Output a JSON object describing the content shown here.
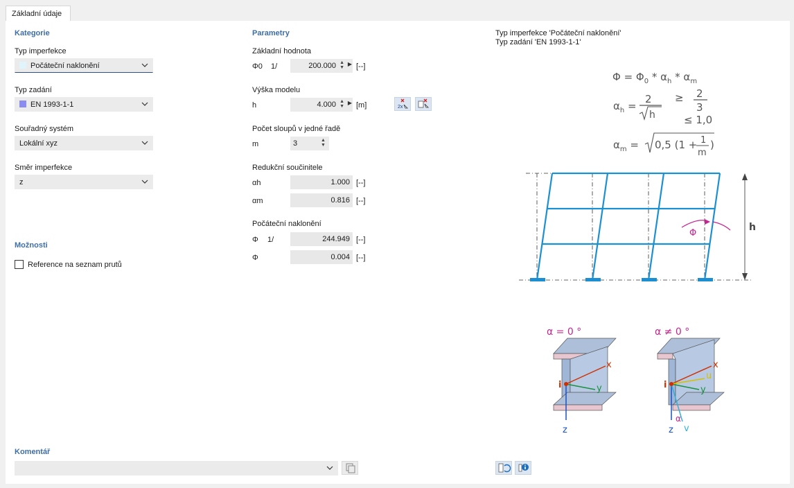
{
  "tab": {
    "label": "Základní údaje"
  },
  "kategorie": {
    "title": "Kategorie",
    "typ_imperfekce": {
      "label": "Typ imperfekce",
      "value": "Počáteční naklonění",
      "swatch": "#dff4fb"
    },
    "typ_zadani": {
      "label": "Typ zadání",
      "value": "EN 1993-1-1",
      "swatch": "#8c8cf0"
    },
    "soustava": {
      "label": "Souřadný systém",
      "value": "Lokální xyz"
    },
    "smer": {
      "label": "Směr imperfekce",
      "value": "z"
    }
  },
  "moznosti": {
    "title": "Možnosti",
    "reference_label": "Reference na seznam prutů",
    "reference_checked": false
  },
  "komentar": {
    "title": "Komentář",
    "value": ""
  },
  "parametry": {
    "title": "Parametry",
    "zakladni": {
      "label": "Základní hodnota",
      "sym": "Φ0",
      "prefix": "1/",
      "value": "200.000",
      "unit": "[--]"
    },
    "vyska": {
      "label": "Výška modelu",
      "sym": "h",
      "value": "4.000",
      "unit": "[m]"
    },
    "pocet": {
      "label": "Počet sloupů v jedné řadě",
      "sym": "m",
      "value": "3"
    },
    "redukcni": {
      "label": "Redukční součinitele",
      "ah": {
        "sym": "αh",
        "value": "1.000",
        "unit": "[--]"
      },
      "am": {
        "sym": "αm",
        "value": "0.816",
        "unit": "[--]"
      }
    },
    "naklon": {
      "label": "Počáteční naklonění",
      "phi_inv": {
        "sym": "Φ",
        "prefix": "1/",
        "value": "244.949",
        "unit": "[--]"
      },
      "phi": {
        "sym": "Φ",
        "value": "0.004",
        "unit": "[--]"
      }
    }
  },
  "info": {
    "line1": "Typ imperfekce 'Počáteční naklonění'",
    "line2": "Typ zadání 'EN 1993-1-1'",
    "formula": {
      "phi": "Φ = Φ",
      "phi_sub": "0",
      "phi_rest1": " * α",
      "phi_rest2": " * α",
      "h_sub": "h",
      "m_sub": "m",
      "ah_lhs": "α",
      "two": "2",
      "sqrt_h": "h",
      "ge": "≥",
      "two_b": "2",
      "three": "3",
      "le": "≤ 1,0",
      "am_lhs": "α",
      "am_expr": "0,5 (1 +",
      "one": "1",
      "m": "m",
      "close": ")"
    },
    "frame_label_h": "h",
    "frame_label_phi": "Φ",
    "section1": {
      "label": "α = 0 °",
      "x": "x",
      "y": "y",
      "z": "z",
      "i": "i"
    },
    "section2": {
      "label": "α ≠ 0 °",
      "x": "x",
      "y": "y",
      "z": "z",
      "i": "i",
      "u": "u",
      "v": "v",
      "alpha": "α"
    }
  },
  "colors": {
    "accent": "#3d6ea8",
    "frame": "#1b8fd2",
    "magenta": "#c4268f"
  }
}
